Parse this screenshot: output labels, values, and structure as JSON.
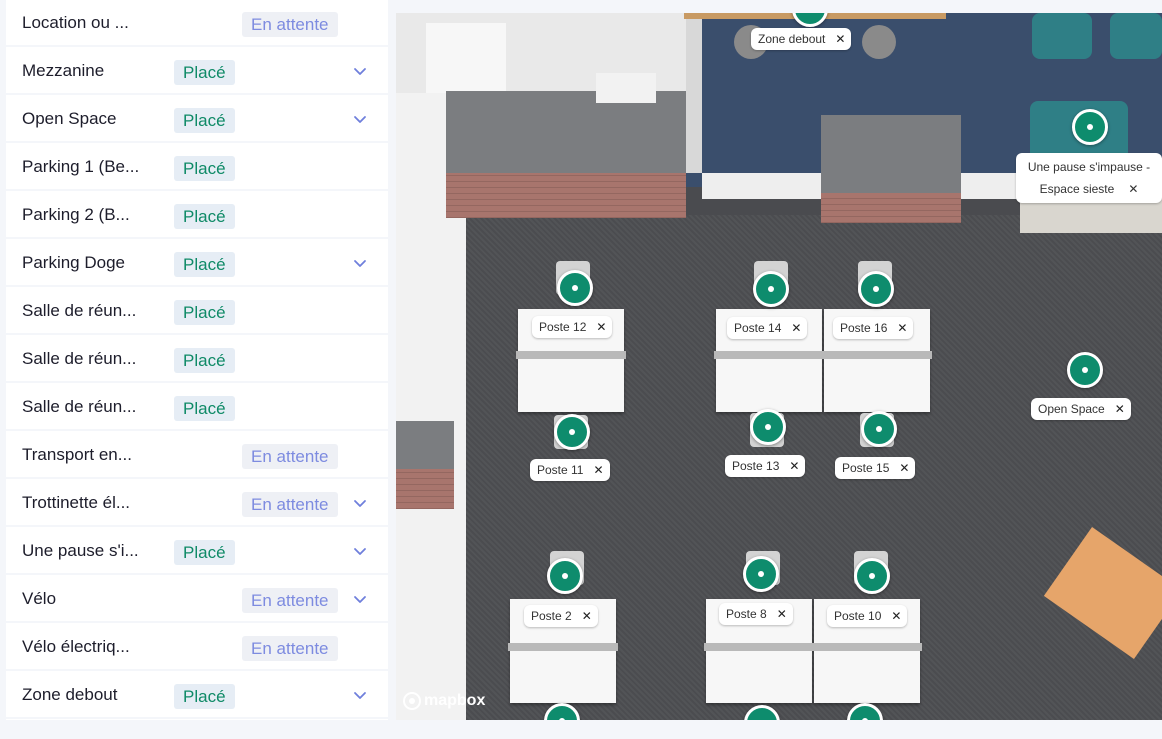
{
  "list": {
    "rows": [
      {
        "name": "Location ou ...",
        "status": "En attente",
        "type": "pending",
        "chevron": false
      },
      {
        "name": "Mezzanine",
        "status": "Placé",
        "type": "placed",
        "chevron": true
      },
      {
        "name": "Open Space",
        "status": "Placé",
        "type": "placed",
        "chevron": true
      },
      {
        "name": "Parking 1 (Be...",
        "status": "Placé",
        "type": "placed",
        "chevron": false
      },
      {
        "name": "Parking 2 (B...",
        "status": "Placé",
        "type": "placed",
        "chevron": false
      },
      {
        "name": "Parking Doge",
        "status": "Placé",
        "type": "placed",
        "chevron": true
      },
      {
        "name": "Salle de réun...",
        "status": "Placé",
        "type": "placed",
        "chevron": false
      },
      {
        "name": "Salle de réun...",
        "status": "Placé",
        "type": "placed",
        "chevron": false
      },
      {
        "name": "Salle de réun...",
        "status": "Placé",
        "type": "placed",
        "chevron": false
      },
      {
        "name": "Transport en...",
        "status": "En attente",
        "type": "pending",
        "chevron": false
      },
      {
        "name": "Trottinette él...",
        "status": "En attente",
        "type": "pending",
        "chevron": true
      },
      {
        "name": "Une pause s'i...",
        "status": "Placé",
        "type": "placed",
        "chevron": true
      },
      {
        "name": "Vélo",
        "status": "En attente",
        "type": "pending",
        "chevron": true
      },
      {
        "name": "Vélo électriq...",
        "status": "En attente",
        "type": "pending",
        "chevron": false
      },
      {
        "name": "Zone debout",
        "status": "Placé",
        "type": "placed",
        "chevron": true
      }
    ]
  },
  "map": {
    "labels": {
      "zone_debout": "Zone debout",
      "pause_line1": "Une pause s'impause -",
      "pause_line2": "Espace sieste",
      "open_space": "Open Space",
      "poste_12": "Poste 12",
      "poste_14": "Poste 14",
      "poste_16": "Poste 16",
      "poste_11": "Poste 11",
      "poste_13": "Poste 13",
      "poste_15": "Poste 15",
      "poste_2": "Poste 2",
      "poste_8": "Poste 8",
      "poste_10": "Poste 10"
    },
    "close_glyph": "✕",
    "attribution": "mapbox"
  },
  "colors": {
    "placed_text": "#0f8a67",
    "placed_bg": "#e6edf5",
    "pending_text": "#7d8be0",
    "pending_bg": "#eef0f5",
    "pin": "#0e8c6d",
    "chevron": "#6f7fdc"
  },
  "icons": {
    "chevron": "chevron-down-icon",
    "close": "close-icon",
    "pin": "map-pin-icon",
    "logo": "mapbox-logo-icon"
  }
}
